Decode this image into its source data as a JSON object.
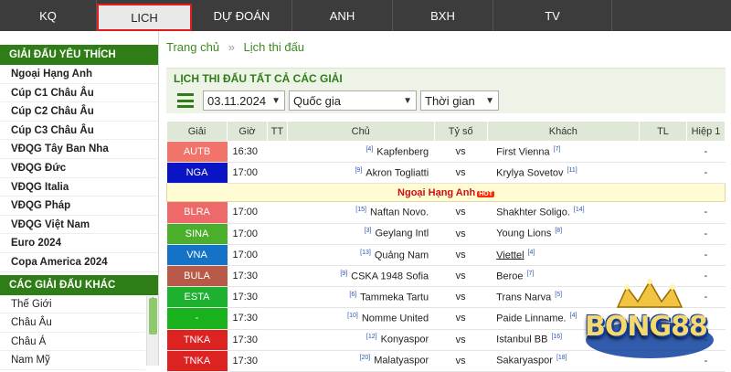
{
  "nav": {
    "tabs": [
      {
        "label": "KQ",
        "active": false
      },
      {
        "label": "LICH",
        "active": true
      },
      {
        "label": "DỰ ĐOÁN",
        "active": false
      },
      {
        "label": "ANH",
        "active": false
      },
      {
        "label": "BXH",
        "active": false
      },
      {
        "label": "TV",
        "active": false
      },
      {
        "label": "",
        "active": false
      }
    ]
  },
  "sidebar": {
    "favorites_title": "GIẢI ĐẤU YÊU THÍCH",
    "favorites": [
      "Ngoại Hạng Anh",
      "Cúp C1 Châu Âu",
      "Cúp C2 Châu Âu",
      "Cúp C3 Châu Âu",
      "VĐQG Tây Ban Nha",
      "VĐQG Đức",
      "VĐQG Italia",
      "VĐQG Pháp",
      "VĐQG Việt Nam",
      "Euro 2024",
      "Copa America 2024"
    ],
    "others_title": "CÁC GIẢI ĐẤU KHÁC",
    "others": [
      "Thế Giới",
      "Châu Âu",
      "Châu Á",
      "Nam Mỹ"
    ]
  },
  "breadcrumb": {
    "home": "Trang chủ",
    "sep": "»",
    "current": "Lịch thi đấu"
  },
  "section_title": "LỊCH THI ĐẤU TẤT CẢ CÁC GIẢI",
  "filters": {
    "date": "03.11.2024",
    "country": "Quốc gia",
    "time": "Thời gian"
  },
  "table": {
    "headers": [
      "Giải",
      "Giờ",
      "TT",
      "Chủ",
      "Tỷ số",
      "Khách",
      "TL",
      "Hiệp 1"
    ],
    "rows_before": [
      {
        "league": "AUTB",
        "color": "#f2736a",
        "time": "16:30",
        "home": "Kapfenberg",
        "home_rank": "[4]",
        "score": "vs",
        "away": "First Vienna",
        "away_rank": "[7]",
        "h1": "-"
      },
      {
        "league": "NGA",
        "color": "#0a14c4",
        "time": "17:00",
        "home": "Akron Togliatti",
        "home_rank": "[9]",
        "score": "vs",
        "away": "Krylya Sovetov",
        "away_rank": "[11]",
        "h1": "-"
      }
    ],
    "hot_label": "Ngoại Hạng Anh",
    "hot_badge": "HOT",
    "rows_after": [
      {
        "league": "BLRA",
        "color": "#ee6a6a",
        "time": "17:00",
        "home": "Naftan Novo.",
        "home_rank": "[15]",
        "score": "vs",
        "away": "Shakhter Soligo.",
        "away_rank": "[14]",
        "h1": "-"
      },
      {
        "league": "SINA",
        "color": "#4caf2c",
        "time": "17:00",
        "home": "Geylang Intl",
        "home_rank": "[3]",
        "score": "vs",
        "away": "Young Lions",
        "away_rank": "[8]",
        "h1": "-"
      },
      {
        "league": "VNA",
        "color": "#1473c6",
        "time": "17:00",
        "home": "Quảng Nam",
        "home_rank": "[13]",
        "score": "vs",
        "away": "Viettel",
        "away_rank": "[4]",
        "h1": "-"
      },
      {
        "league": "BULA",
        "color": "#b85a47",
        "time": "17:30",
        "home": "CSKA 1948 Sofia",
        "home_rank": "[9]",
        "score": "vs",
        "away": "Beroe",
        "away_rank": "[7]",
        "h1": "-"
      },
      {
        "league": "ESTA",
        "color": "#1db12f",
        "time": "17:30",
        "home": "Tammeka Tartu",
        "home_rank": "[6]",
        "score": "vs",
        "away": "Trans Narva",
        "away_rank": "[5]",
        "h1": "-"
      },
      {
        "league": "-",
        "color": "#19b21c",
        "time": "17:30",
        "home": "Nomme United",
        "home_rank": "[10]",
        "score": "vs",
        "away": "Paide Linname.",
        "away_rank": "[4]",
        "h1": "-"
      },
      {
        "league": "TNKA",
        "color": "#dd2222",
        "time": "17:30",
        "home": "Konyaspor",
        "home_rank": "[12]",
        "score": "vs",
        "away": "Istanbul BB",
        "away_rank": "[16]",
        "h1": "-"
      },
      {
        "league": "TNKA",
        "color": "#dd2222",
        "time": "17:30",
        "home": "Malatyaspor",
        "home_rank": "[20]",
        "score": "vs",
        "away": "Sakaryaspor",
        "away_rank": "[18]",
        "h1": "-"
      }
    ]
  },
  "logo": {
    "text": "BONG88"
  }
}
